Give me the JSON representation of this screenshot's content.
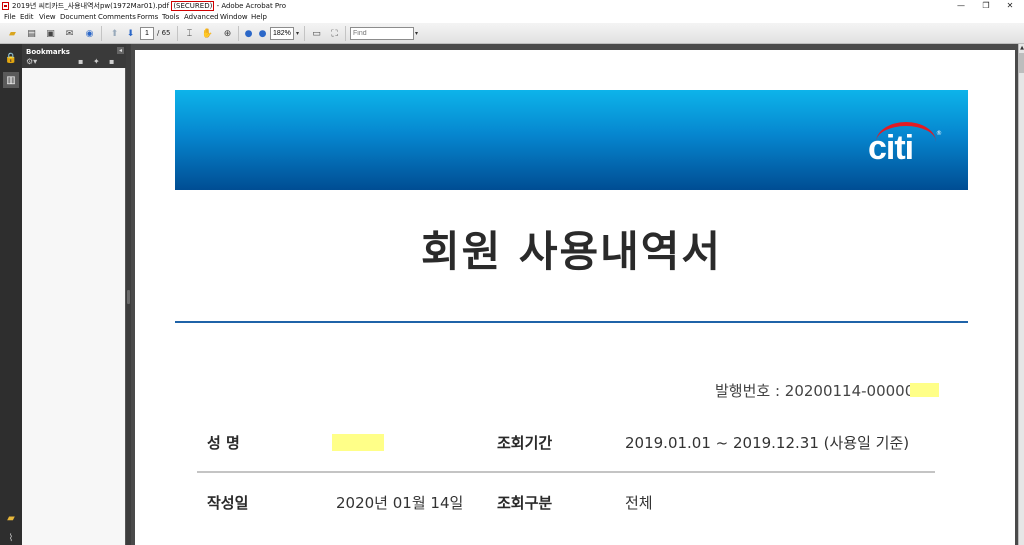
{
  "window": {
    "title_prefix": "2019년 씨티카드_사용내역서pw(1972Mar01).pdf ",
    "secured_label": "(SECURED)",
    "title_suffix": " - Adobe Acrobat Pro",
    "minimize_glyph": "—",
    "restore_glyph": "❐",
    "close_glyph": "✕"
  },
  "menu": [
    "File",
    "Edit",
    "View",
    "Document",
    "Comments",
    "Forms",
    "Tools",
    "Advanced",
    "Window",
    "Help"
  ],
  "toolbar": {
    "current_page": "1",
    "page_total": "/ 65",
    "zoom": "182%",
    "find_placeholder": "Find",
    "icons": {
      "open": "open-folder-icon",
      "print": "print-icon",
      "save": "save-icon",
      "email": "email-icon",
      "globe": "globe-icon",
      "prev": "previous-page-icon",
      "next": "next-page-icon",
      "select": "select-tool-icon",
      "hand": "hand-tool-icon",
      "marquee_zoom": "marquee-zoom-icon",
      "zoom_out": "zoom-out-icon",
      "zoom_in": "zoom-in-icon",
      "fit_page": "fit-page-icon",
      "fit_width": "fit-width-icon"
    }
  },
  "bookmarks_panel": {
    "title": "Bookmarks"
  },
  "document": {
    "brand": "citi",
    "title": "회원 사용내역서",
    "issue_number": "발행번호 : 20200114-00000",
    "rows": [
      {
        "label1": "성 명",
        "value1": "",
        "label2": "조회기간",
        "value2": "2019.01.01 ~ 2019.12.31 (사용일 기준)"
      },
      {
        "label1": "작성일",
        "value1": "2020년 01월 14일",
        "label2": "조회구분",
        "value2": "전체"
      }
    ],
    "colors": {
      "banner_top": "#0db4ea",
      "banner_bottom": "#004d93",
      "rule": "#1f63a8",
      "redaction": "#ffff88",
      "citi_arc": "#e31b23"
    }
  }
}
